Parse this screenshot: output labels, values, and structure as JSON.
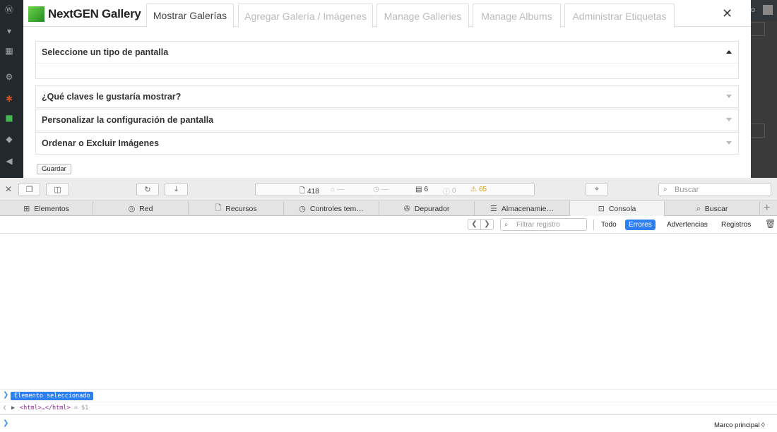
{
  "modal": {
    "logo_text": "NextGEN Gallery",
    "tabs": [
      {
        "label": "Mostrar Galerías",
        "active": true
      },
      {
        "label": "Agregar Galería / Imágenes",
        "active": false
      },
      {
        "label": "Manage Galleries",
        "active": false
      },
      {
        "label": "Manage Albums",
        "active": false
      },
      {
        "label": "Administrar Etiquetas",
        "active": false
      }
    ],
    "close_glyph": "✕",
    "sections": [
      {
        "title": "Seleccione un tipo de pantalla",
        "expanded": true
      },
      {
        "title": "¿Qué claves le gustaría mostrar?",
        "expanded": false
      },
      {
        "title": "Personalizar la configuración de pantalla",
        "expanded": false
      },
      {
        "title": "Ordenar o Excluir Imágenes",
        "expanded": false
      }
    ],
    "save_label": "Guardar"
  },
  "wp_admin": {
    "user_text": "o"
  },
  "devtools": {
    "status": {
      "resources": "418",
      "size": "—",
      "time": "—",
      "logs": "6",
      "errors": "0",
      "warnings": "65"
    },
    "search_placeholder": "Buscar",
    "tabs": [
      {
        "label": "Elementos",
        "icon": "elements-icon"
      },
      {
        "label": "Red",
        "icon": "network-icon"
      },
      {
        "label": "Recursos",
        "icon": "resources-icon"
      },
      {
        "label": "Controles tem…",
        "icon": "timelines-icon"
      },
      {
        "label": "Depurador",
        "icon": "debugger-icon"
      },
      {
        "label": "Almacenamie…",
        "icon": "storage-icon"
      },
      {
        "label": "Consola",
        "icon": "console-icon",
        "selected": true
      },
      {
        "label": "Buscar",
        "icon": "search-icon"
      }
    ],
    "console": {
      "filter_placeholder": "Filtrar registro",
      "filters": [
        {
          "label": "Todo",
          "active": false
        },
        {
          "label": "Errores",
          "active": true
        },
        {
          "label": "Advertencias",
          "active": false
        },
        {
          "label": "Registros",
          "active": false
        }
      ],
      "selected_badge": "Elemento seleccionado",
      "html_node": "<html>…</html>",
      "equals": "=",
      "var_ref": "$1",
      "frame_selector": "Marco principal ◊"
    }
  }
}
